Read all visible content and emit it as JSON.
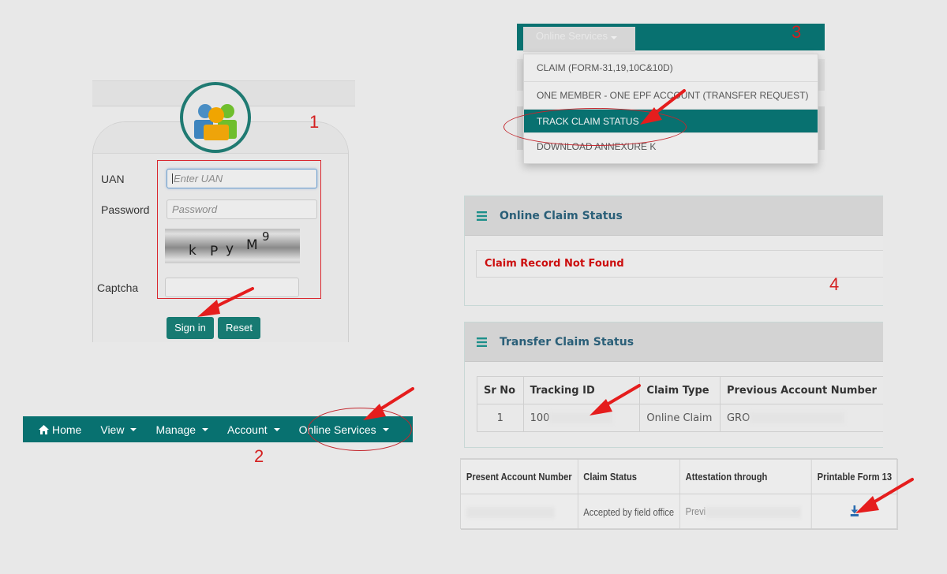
{
  "steps": [
    "1",
    "2",
    "3",
    "4"
  ],
  "login": {
    "uan_label": "UAN",
    "uan_placeholder": "Enter UAN",
    "password_label": "Password",
    "password_placeholder": "Password",
    "captcha_chars": [
      "k",
      "P",
      "y",
      "M",
      "9"
    ],
    "captcha_label": "Captcha",
    "captcha_value": "",
    "sign_in_label": "Sign in",
    "reset_label": "Reset"
  },
  "navbar": {
    "items": [
      {
        "label": "Home",
        "icon": "home-icon",
        "dropdown": false
      },
      {
        "label": "View",
        "dropdown": true
      },
      {
        "label": "Manage",
        "dropdown": true
      },
      {
        "label": "Account",
        "dropdown": true
      },
      {
        "label": "Online Services",
        "dropdown": true
      }
    ]
  },
  "dropdown": {
    "tab_label": "Online Services",
    "items": [
      {
        "label": "CLAIM (FORM-31,19,10C&10D)",
        "active": false
      },
      {
        "label": "ONE MEMBER - ONE EPF ACCOUNT (TRANSFER REQUEST)",
        "active": false
      },
      {
        "label": "TRACK CLAIM STATUS",
        "active": true
      },
      {
        "label": "DOWNLOAD ANNEXURE K",
        "active": false
      }
    ]
  },
  "online_claim": {
    "title": "Online Claim Status",
    "message": "Claim Record Not Found"
  },
  "transfer_claim": {
    "title": "Transfer Claim Status",
    "columns": [
      "Sr No",
      "Tracking ID",
      "Claim Type",
      "Previous Account Number"
    ],
    "rows": [
      {
        "sr_no": "1",
        "tracking_id": "100",
        "claim_type": "Online Claim",
        "previous_account": "GRO"
      }
    ]
  },
  "transfer_claim_cont": {
    "columns": [
      "Present Account Number",
      "Claim Status",
      "Attestation through",
      "Printable Form 13"
    ],
    "rows": [
      {
        "present_account": "",
        "claim_status": "Accepted by field office",
        "attestation": "Previ",
        "form13_icon": "download-icon"
      }
    ]
  },
  "colors": {
    "teal": "#087170",
    "annotation_red": "#d41f1f",
    "panel_title": "#2a5f78",
    "error_red": "#cc0e0e"
  }
}
